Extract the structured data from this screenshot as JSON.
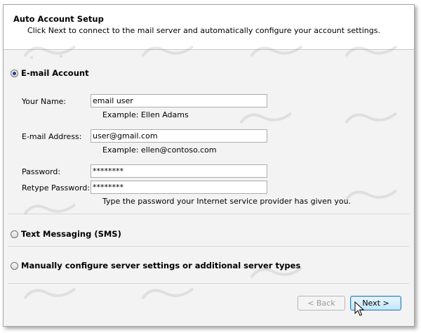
{
  "header": {
    "title": "Auto Account Setup",
    "subtitle": "Click Next to connect to the mail server and automatically configure your account settings."
  },
  "options": {
    "email_account": {
      "label": "E-mail Account",
      "selected": true
    },
    "sms": {
      "label": "Text Messaging (SMS)",
      "selected": false
    },
    "manual": {
      "label": "Manually configure server settings or additional server types",
      "selected": false
    }
  },
  "form": {
    "name_label": "Your Name:",
    "name_value": "email user",
    "name_example": "Example: Ellen Adams",
    "email_label": "E-mail Address:",
    "email_value": "user@gmail.com",
    "email_example": "Example: ellen@contoso.com",
    "password_label": "Password:",
    "password_value": "********",
    "retype_label": "Retype Password:",
    "retype_value": "********",
    "password_hint": "Type the password your Internet service provider has given you."
  },
  "buttons": {
    "back_label": "< Back",
    "next_label": "Next >"
  },
  "icons": {
    "cursor": "mouse-pointer-icon",
    "watermark": "watermark-logo"
  },
  "colors": {
    "header_bg": "#ffffff",
    "body_bg": "#f3f3f3",
    "next_button_border": "#3c7fb1"
  }
}
